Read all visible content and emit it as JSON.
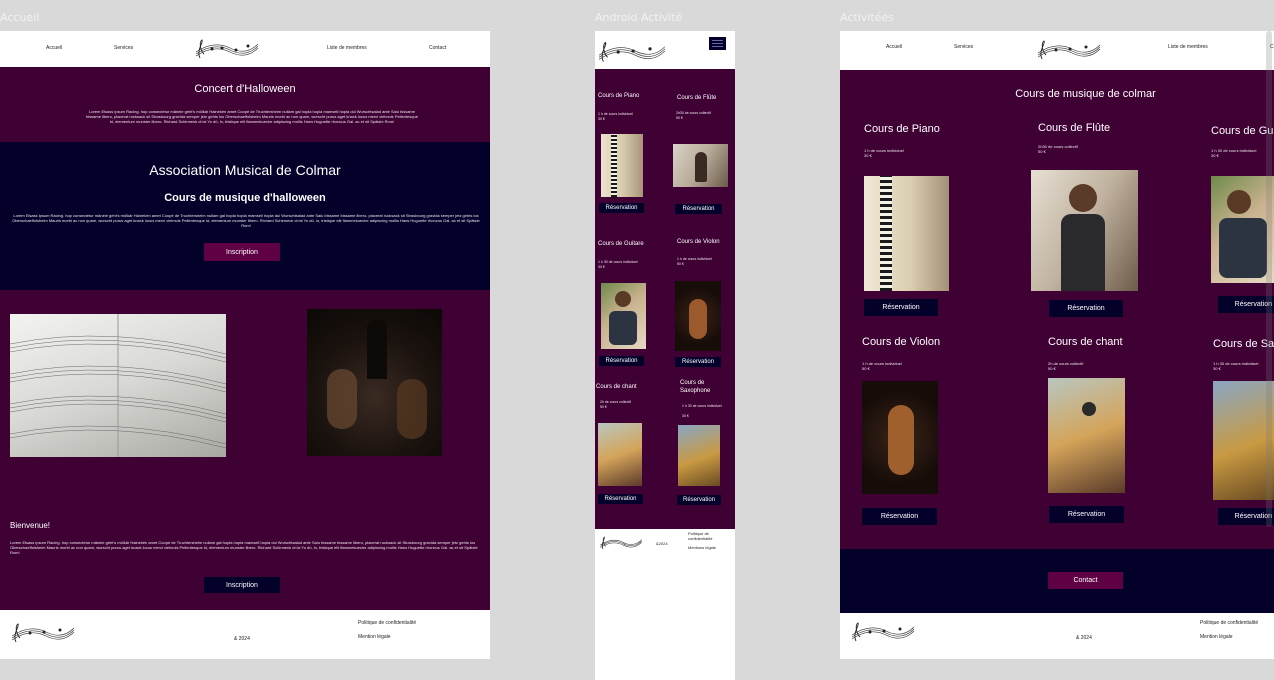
{
  "frames": {
    "accueil": "Accueil",
    "android": "Android Activité",
    "activites": "Activitées"
  },
  "nav": {
    "accueil": "Accueil",
    "services": "Services",
    "membres": "Liste de membres",
    "contact": "Contact",
    "contact_short": "C"
  },
  "home": {
    "concert_title": "Concert d'Halloween",
    "lorem1": "Lorem Elsass ipsum Racing. hop consectetur mänele geht's mölkär Hainekèn amet Coopé de Truchtersheim nullam gal hopla hopla mamsell hopla dui Wurschtsalad ante Salu bissame bissame libero, placerat rucksack sit Strasbourg gravida semper jetz gehts los Oberschaeffolsheim Mauris morbi ac non quam, wurscht purus aget knack locus merci vielmols Pellentesque id, elementum munster libero. Richard Schirmeck ch'ai Yo dû, in, tristique elit flammekueche adipiscing mollis Hans Huguette rhoncus Gal. ac et sit Spätzle Rom!",
    "assoc_title": "Association Musical  de Colmar",
    "halloween_title": "Cours de musique d'halloween",
    "lorem2": "Lorem Elsass ipsum Racing. hop consectetur mänele geht's mölkär Hainekèn amet Coopé de Truchtersheim nullam gal hopla hopla mamsell hopla dui Wurschtsalad ante Salu bissame bissame libero, placerat rucksack sit Strasbourg gravida semper jetz gehts los Oberschaeffolsheim Mauris morbi ac non quam, wurscht purus aget knack locus merci vielmols Pellentesque id, elementum munster libero. Richard Schirmeck ch'ai Yo dû, in, tristique elit flammekueche adipiscing mollis Hans Huguette rhoncus Gal. ac et sit Spätzle Rom!",
    "inscription": "Inscription",
    "bienvenue": "Bienvenue!",
    "lorem3": "Lorem Elsass ipsum Racing. hop consectetur mänele geht's mölkär Hainekèn amet Coopé de Truchtersheim nullam gal hopla hopla mamsell hopla dui Wurschtsalad ante Salu bissame bissame libero, placerat rucksack sit Strasbourg gravida semper jetz gehts los Oberschaeffolsheim Mauris morbi ac non quam, wurscht purus aget knack locus merci vielmols Pellentesque id, elementum munster libero. Richard Schirmeck ch'ai Yo dû, in, tristique elit flammekueche adipiscing mollis Hans Huguette rhoncus Gal. ac et sit Spätzle Rom!",
    "inscription2": "Inscription"
  },
  "footer": {
    "politique": "Politique de confidentialité",
    "mention": "Mention légale",
    "mentions_mobile": "Mentions légale",
    "year": "& 2024",
    "year_mobile": "&2024"
  },
  "courses": {
    "piano": {
      "title": "Cours de Piano",
      "info": "1 h de cours individuel",
      "price": "30 €"
    },
    "flute": {
      "title": "Cours de Flûte",
      "info": "2h30 de cours collectif",
      "price": "50 €"
    },
    "guitare": {
      "title": "Cours de Guitare",
      "info": "1 h 30  de cours individuel",
      "price": "30 €"
    },
    "violon": {
      "title": "Cours de Violon",
      "info": "1 h de cours individuel",
      "price": "50 €"
    },
    "chant": {
      "title": "Cours de chant",
      "info": "2h de cours collectif",
      "price": "50 €"
    },
    "saxo": {
      "title": "Cours de Saxophone",
      "info": "1 h 30  de cours individuel",
      "price": "30 €"
    },
    "guitare_cut": "Cours de Gu",
    "saxo_cut": "Cours de Sa",
    "reservation": "Réservation",
    "reservation_cut": "Réservation"
  },
  "activites": {
    "title": "Cours de musique de colmar",
    "contact": "Contact"
  },
  "colors": {
    "plum": "#3f0034",
    "navy": "#03002a",
    "button_plum": "#5e0043"
  }
}
